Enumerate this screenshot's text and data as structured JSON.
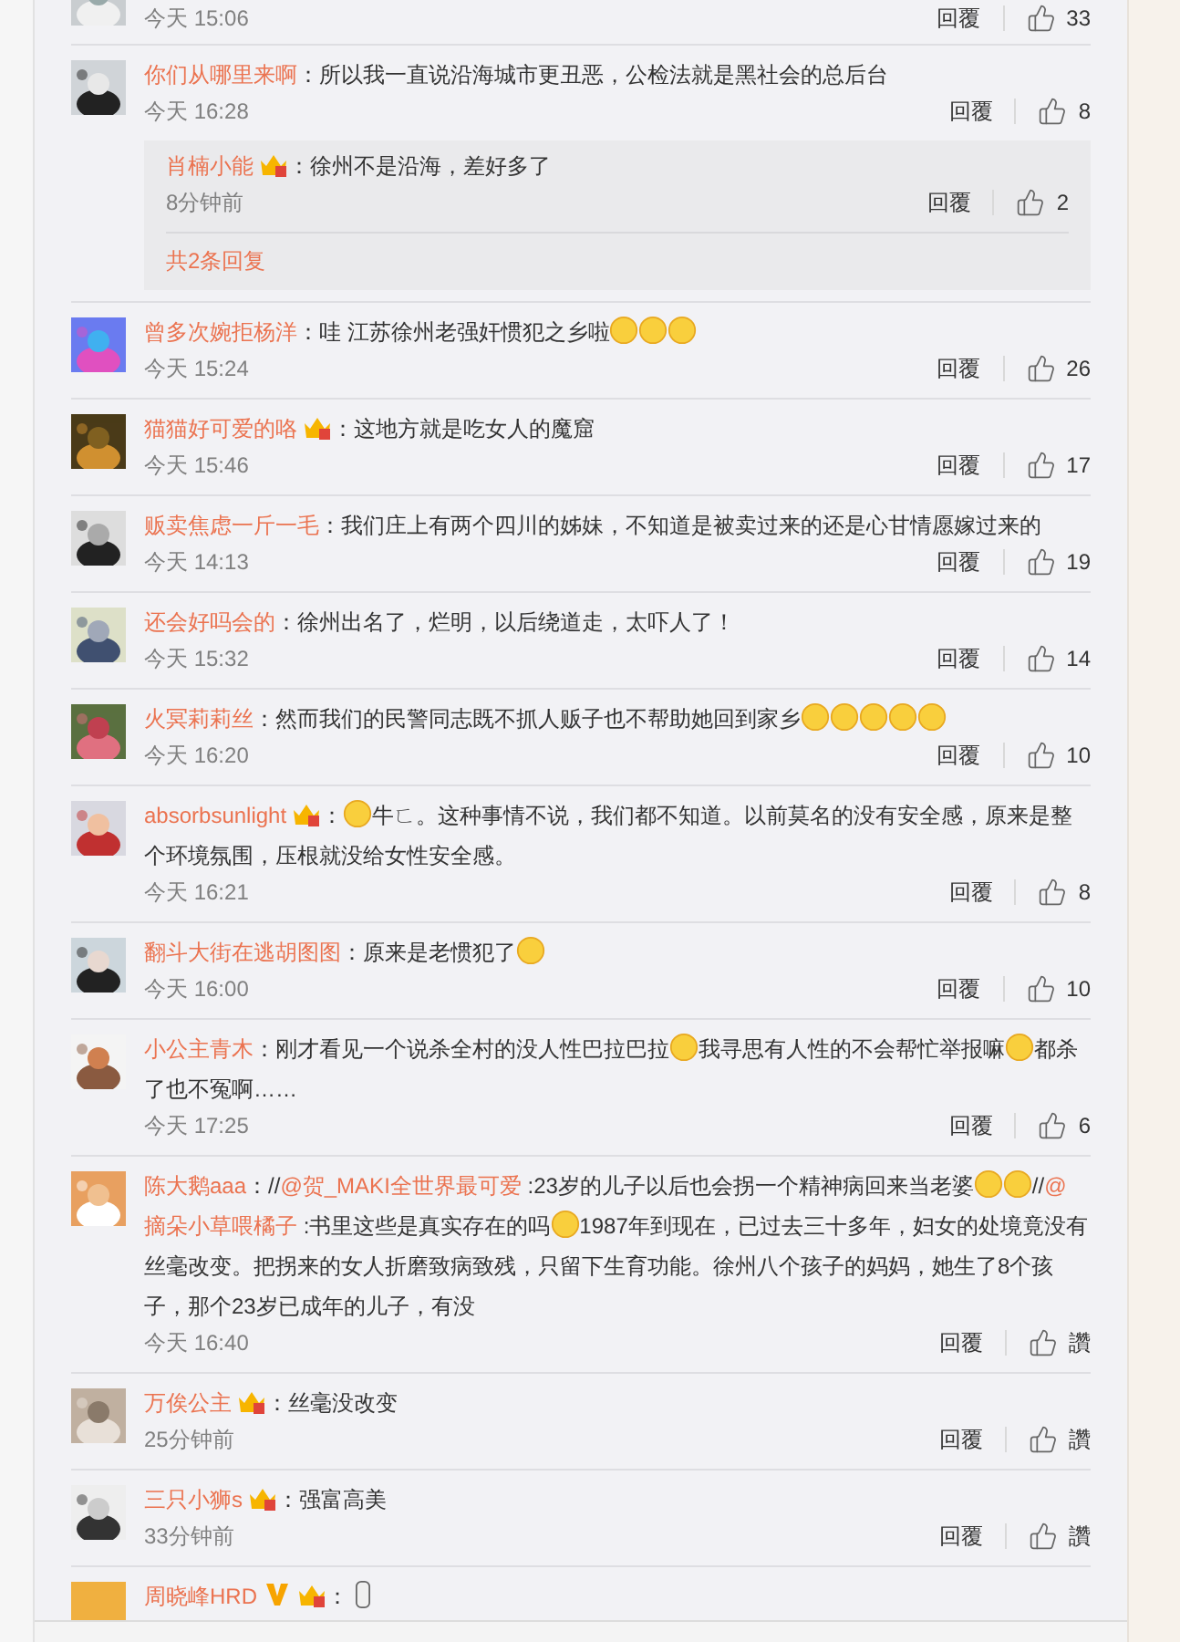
{
  "comments": [
    {
      "time": "今天 15:06",
      "reply": "回覆",
      "likes": "33"
    },
    {
      "name": "你们从哪里来啊",
      "lines": [
        [
          {
            "kind": "text",
            "text": "：所以我一直说沿海城市更丑恶，公检法就是黑社会的总后台"
          }
        ]
      ],
      "time": "今天 16:28",
      "reply": "回覆",
      "likes": "8",
      "replies": {
        "items": [
          {
            "name": "肖楠小能",
            "badges": [
              {
                "kind": "crown"
              }
            ],
            "lines": [
              [
                {
                  "kind": "text",
                  "text": "：徐州不是沿海，差好多了"
                }
              ]
            ],
            "time": "8分钟前",
            "reply": "回覆",
            "likes": "2"
          }
        ],
        "more": "共2条回复"
      }
    },
    {
      "name": "曾多次婉拒杨洋",
      "lines": [
        [
          {
            "kind": "text",
            "text": "：哇 江苏徐州老强奸惯犯之乡啦"
          },
          {
            "kind": "emoji"
          },
          {
            "kind": "emoji"
          },
          {
            "kind": "emoji"
          }
        ]
      ],
      "time": "今天 15:24",
      "reply": "回覆",
      "likes": "26"
    },
    {
      "name": "猫猫好可爱的咯",
      "badges": [
        {
          "kind": "crown"
        }
      ],
      "lines": [
        [
          {
            "kind": "text",
            "text": "：这地方就是吃女人的魔窟"
          }
        ]
      ],
      "time": "今天 15:46",
      "reply": "回覆",
      "likes": "17"
    },
    {
      "name": "贩卖焦虑一斤一毛",
      "lines": [
        [
          {
            "kind": "text",
            "text": "：我们庄上有两个四川的姊妹，不知道是被卖过来的还是心甘情愿嫁过来的"
          }
        ]
      ],
      "time": "今天 14:13",
      "reply": "回覆",
      "likes": "19"
    },
    {
      "name": "还会好吗会的",
      "lines": [
        [
          {
            "kind": "text",
            "text": "：徐州出名了，烂明，以后绕道走，太吓人了！"
          }
        ]
      ],
      "time": "今天 15:32",
      "reply": "回覆",
      "likes": "14"
    },
    {
      "name": "火冥莉莉丝",
      "lines": [
        [
          {
            "kind": "text",
            "text": "：然而我们的民警同志既不抓人贩子也不帮助她回到家乡"
          },
          {
            "kind": "emoji"
          },
          {
            "kind": "emoji"
          },
          {
            "kind": "emoji"
          },
          {
            "kind": "emoji"
          },
          {
            "kind": "emoji"
          }
        ]
      ],
      "time": "今天 16:20",
      "reply": "回覆",
      "likes": "10"
    },
    {
      "name": "absorbsunlight",
      "badges": [
        {
          "kind": "crown"
        }
      ],
      "lines": [
        [
          {
            "kind": "text",
            "text": "："
          },
          {
            "kind": "emoji"
          },
          {
            "kind": "text",
            "text": "牛ㄈ。这种事情不说，我们都不知道。以前莫名的没有安全感，原来是整"
          }
        ],
        [
          {
            "kind": "text",
            "text": "个环境氛围，压根就没给女性安全感。"
          }
        ]
      ],
      "time": "今天 16:21",
      "reply": "回覆",
      "likes": "8"
    },
    {
      "name": "翻斗大街在逃胡图图",
      "lines": [
        [
          {
            "kind": "text",
            "text": "：原来是老惯犯了"
          },
          {
            "kind": "emoji"
          }
        ]
      ],
      "time": "今天 16:00",
      "reply": "回覆",
      "likes": "10"
    },
    {
      "name": "小公主青木",
      "lines": [
        [
          {
            "kind": "text",
            "text": "：刚才看见一个说杀全村的没人性巴拉巴拉"
          },
          {
            "kind": "emoji"
          },
          {
            "kind": "text",
            "text": "我寻思有人性的不会帮忙举报嘛"
          },
          {
            "kind": "emoji"
          },
          {
            "kind": "text",
            "text": "都杀"
          }
        ],
        [
          {
            "kind": "text",
            "text": "了也不冤啊……"
          }
        ]
      ],
      "time": "今天 17:25",
      "reply": "回覆",
      "likes": "6"
    },
    {
      "name": "陈大鹅aaa",
      "lines": [
        [
          {
            "kind": "text",
            "text": "：//"
          },
          {
            "kind": "mention",
            "text": "@贺_MAKI全世界最可爱"
          },
          {
            "kind": "text",
            "text": " :23岁的儿子以后也会拐一个精神病回来当老婆"
          },
          {
            "kind": "emoji"
          },
          {
            "kind": "emoji"
          },
          {
            "kind": "text",
            "text": "//"
          },
          {
            "kind": "mention",
            "text": "@"
          }
        ],
        [
          {
            "kind": "mention",
            "text": "摘朵小草喂橘子"
          },
          {
            "kind": "text",
            "text": " :书里这些是真实存在的吗"
          },
          {
            "kind": "emoji"
          },
          {
            "kind": "text",
            "text": "1987年到现在，已过去三十多年，妇女的处境竟没有"
          }
        ],
        [
          {
            "kind": "text",
            "text": "丝毫改变。把拐来的女人折磨致病致残，只留下生育功能。徐州八个孩子的妈妈，她生了8个孩"
          }
        ],
        [
          {
            "kind": "text",
            "text": "子，那个23岁已成年的儿子，有没"
          }
        ]
      ],
      "time": "今天 16:40",
      "reply": "回覆",
      "likes": "讚"
    },
    {
      "name": "万俟公主",
      "badges": [
        {
          "kind": "crown"
        }
      ],
      "lines": [
        [
          {
            "kind": "text",
            "text": "：丝毫没改变"
          }
        ]
      ],
      "time": "25分钟前",
      "reply": "回覆",
      "likes": "讚"
    },
    {
      "name": "三只小狮s",
      "badges": [
        {
          "kind": "crown"
        }
      ],
      "lines": [
        [
          {
            "kind": "text",
            "text": "：强富高美"
          }
        ]
      ],
      "time": "33分钟前",
      "reply": "回覆",
      "likes": "讚"
    },
    {
      "name": "周晓峰HRD",
      "badges": [
        {
          "kind": "verified"
        },
        {
          "kind": "crown"
        }
      ],
      "lines": [
        [
          {
            "kind": "text",
            "text": "："
          },
          {
            "kind": "mic"
          }
        ]
      ]
    }
  ]
}
